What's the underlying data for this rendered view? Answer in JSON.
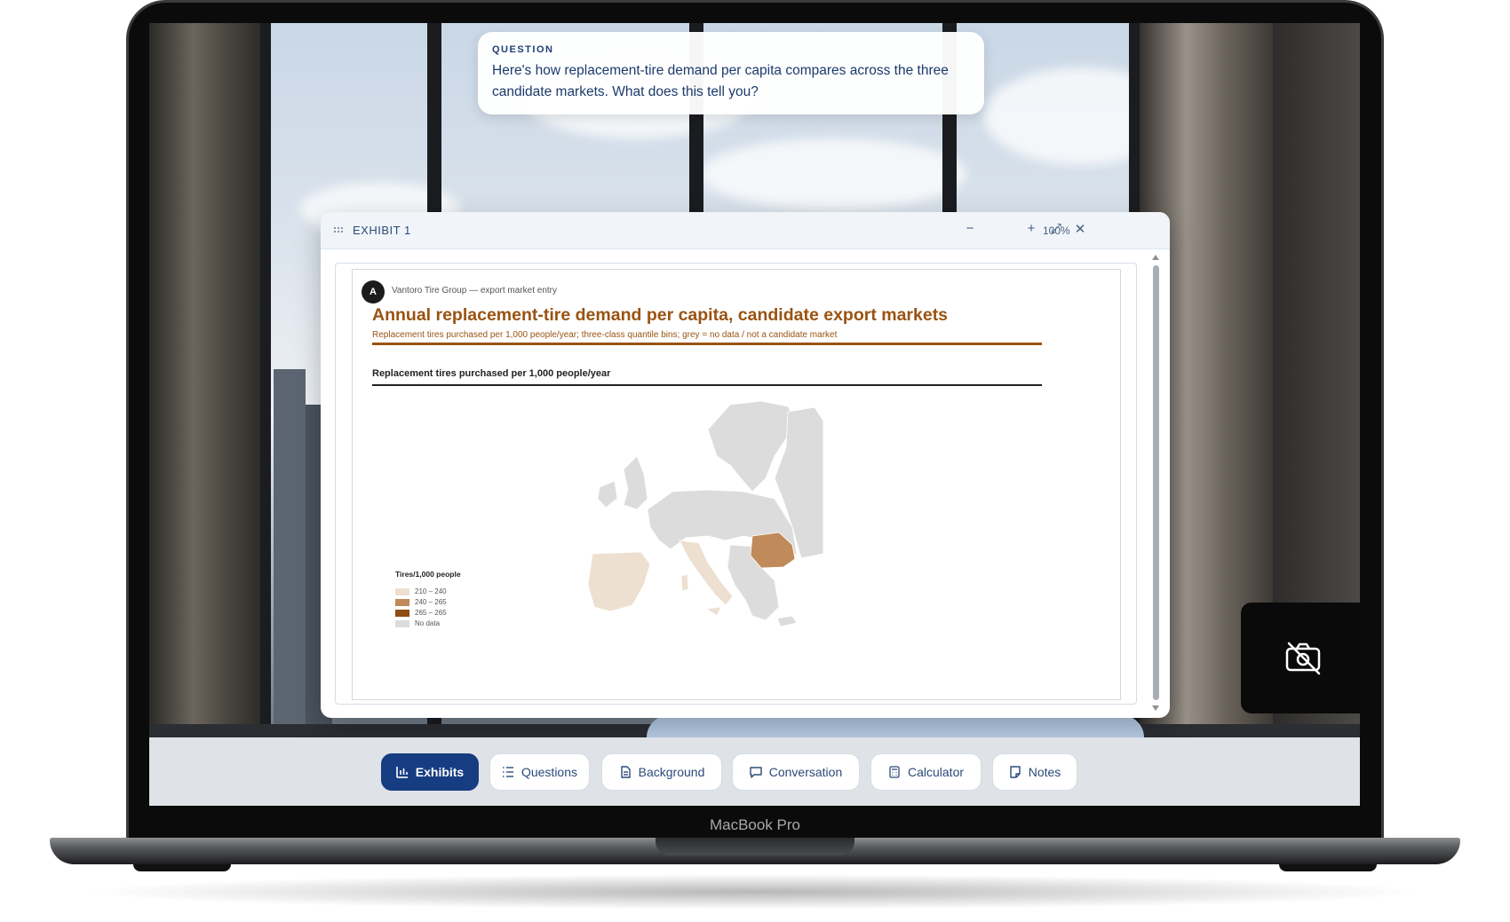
{
  "device": {
    "label": "MacBook Pro"
  },
  "question": {
    "label": "QUESTION",
    "text": "Here's how replacement-tire demand per capita compares across the three candidate markets. What does this tell you?"
  },
  "exhibit": {
    "title": "EXHIBIT 1",
    "zoom_level": "100%",
    "controls": {
      "zoom_out": "−",
      "zoom_in": "+",
      "expand": "⤢",
      "close": "✕"
    },
    "badge": "A",
    "source": "Vantoro Tire Group — export market entry",
    "chart_title": "Annual replacement-tire demand per capita, candidate export markets",
    "chart_subtitle": "Replacement tires purchased per 1,000 people/year; three-class quantile bins; grey = no data / not a candidate market",
    "panel_title": "Replacement tires purchased per 1,000 people/year",
    "legend": {
      "title": "Tires/1,000 people",
      "items": [
        {
          "label": "210 – 240",
          "color": "#ede0d1"
        },
        {
          "label": "240 – 265",
          "color": "#c08a5a"
        },
        {
          "label": "265 – 265",
          "color": "#8e4d12"
        },
        {
          "label": "No data",
          "color": "#dcdcdc"
        }
      ]
    }
  },
  "chart_data": {
    "type": "choropleth",
    "title": "Annual replacement-tire demand per capita, candidate export markets",
    "subtitle": "Replacement tires purchased per 1,000 people/year; three-class quantile bins; grey = no data / not a candidate market",
    "legend_title": "Tires/1,000 people",
    "bins": [
      "210 – 240",
      "240 – 265",
      "265 – 265",
      "No data"
    ],
    "regions": [
      {
        "region": "Iberian Peninsula",
        "bin": "210 – 240"
      },
      {
        "region": "Italian Peninsula",
        "bin": "210 – 240"
      },
      {
        "region": "Romania",
        "bin": "240 – 265"
      }
    ],
    "legend_placement": "bottom-left"
  },
  "nav": {
    "items": [
      {
        "label": "Exhibits",
        "icon": "bar-chart-icon",
        "active": true
      },
      {
        "label": "Questions",
        "icon": "list-icon",
        "active": false
      },
      {
        "label": "Background",
        "icon": "document-icon",
        "active": false
      },
      {
        "label": "Conversation",
        "icon": "chat-icon",
        "active": false
      },
      {
        "label": "Calculator",
        "icon": "calculator-icon",
        "active": false
      },
      {
        "label": "Notes",
        "icon": "note-icon",
        "active": false
      }
    ]
  },
  "camera": {
    "icon": "camera-off-icon"
  }
}
